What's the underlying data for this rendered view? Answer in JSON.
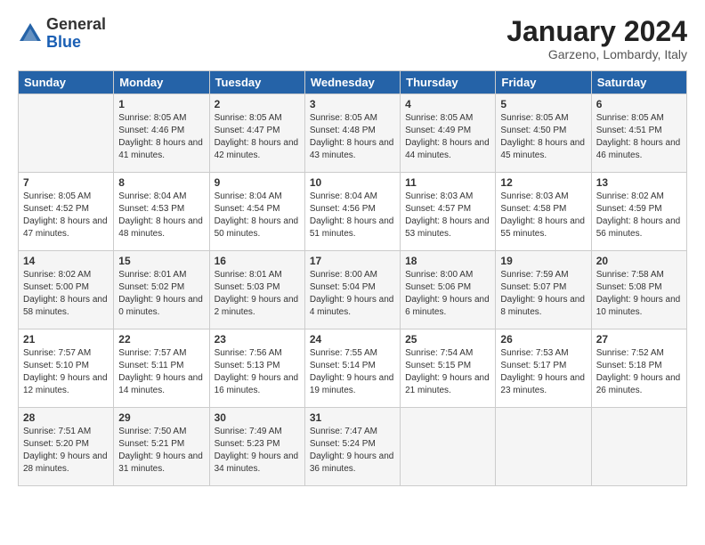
{
  "header": {
    "logo_general": "General",
    "logo_blue": "Blue",
    "month_title": "January 2024",
    "location": "Garzeno, Lombardy, Italy"
  },
  "weekdays": [
    "Sunday",
    "Monday",
    "Tuesday",
    "Wednesday",
    "Thursday",
    "Friday",
    "Saturday"
  ],
  "weeks": [
    [
      {
        "day": "",
        "sunrise": "",
        "sunset": "",
        "daylight": ""
      },
      {
        "day": "1",
        "sunrise": "8:05 AM",
        "sunset": "4:46 PM",
        "daylight": "8 hours and 41 minutes."
      },
      {
        "day": "2",
        "sunrise": "8:05 AM",
        "sunset": "4:47 PM",
        "daylight": "8 hours and 42 minutes."
      },
      {
        "day": "3",
        "sunrise": "8:05 AM",
        "sunset": "4:48 PM",
        "daylight": "8 hours and 43 minutes."
      },
      {
        "day": "4",
        "sunrise": "8:05 AM",
        "sunset": "4:49 PM",
        "daylight": "8 hours and 44 minutes."
      },
      {
        "day": "5",
        "sunrise": "8:05 AM",
        "sunset": "4:50 PM",
        "daylight": "8 hours and 45 minutes."
      },
      {
        "day": "6",
        "sunrise": "8:05 AM",
        "sunset": "4:51 PM",
        "daylight": "8 hours and 46 minutes."
      }
    ],
    [
      {
        "day": "7",
        "sunrise": "8:05 AM",
        "sunset": "4:52 PM",
        "daylight": "8 hours and 47 minutes."
      },
      {
        "day": "8",
        "sunrise": "8:04 AM",
        "sunset": "4:53 PM",
        "daylight": "8 hours and 48 minutes."
      },
      {
        "day": "9",
        "sunrise": "8:04 AM",
        "sunset": "4:54 PM",
        "daylight": "8 hours and 50 minutes."
      },
      {
        "day": "10",
        "sunrise": "8:04 AM",
        "sunset": "4:56 PM",
        "daylight": "8 hours and 51 minutes."
      },
      {
        "day": "11",
        "sunrise": "8:03 AM",
        "sunset": "4:57 PM",
        "daylight": "8 hours and 53 minutes."
      },
      {
        "day": "12",
        "sunrise": "8:03 AM",
        "sunset": "4:58 PM",
        "daylight": "8 hours and 55 minutes."
      },
      {
        "day": "13",
        "sunrise": "8:02 AM",
        "sunset": "4:59 PM",
        "daylight": "8 hours and 56 minutes."
      }
    ],
    [
      {
        "day": "14",
        "sunrise": "8:02 AM",
        "sunset": "5:00 PM",
        "daylight": "8 hours and 58 minutes."
      },
      {
        "day": "15",
        "sunrise": "8:01 AM",
        "sunset": "5:02 PM",
        "daylight": "9 hours and 0 minutes."
      },
      {
        "day": "16",
        "sunrise": "8:01 AM",
        "sunset": "5:03 PM",
        "daylight": "9 hours and 2 minutes."
      },
      {
        "day": "17",
        "sunrise": "8:00 AM",
        "sunset": "5:04 PM",
        "daylight": "9 hours and 4 minutes."
      },
      {
        "day": "18",
        "sunrise": "8:00 AM",
        "sunset": "5:06 PM",
        "daylight": "9 hours and 6 minutes."
      },
      {
        "day": "19",
        "sunrise": "7:59 AM",
        "sunset": "5:07 PM",
        "daylight": "9 hours and 8 minutes."
      },
      {
        "day": "20",
        "sunrise": "7:58 AM",
        "sunset": "5:08 PM",
        "daylight": "9 hours and 10 minutes."
      }
    ],
    [
      {
        "day": "21",
        "sunrise": "7:57 AM",
        "sunset": "5:10 PM",
        "daylight": "9 hours and 12 minutes."
      },
      {
        "day": "22",
        "sunrise": "7:57 AM",
        "sunset": "5:11 PM",
        "daylight": "9 hours and 14 minutes."
      },
      {
        "day": "23",
        "sunrise": "7:56 AM",
        "sunset": "5:13 PM",
        "daylight": "9 hours and 16 minutes."
      },
      {
        "day": "24",
        "sunrise": "7:55 AM",
        "sunset": "5:14 PM",
        "daylight": "9 hours and 19 minutes."
      },
      {
        "day": "25",
        "sunrise": "7:54 AM",
        "sunset": "5:15 PM",
        "daylight": "9 hours and 21 minutes."
      },
      {
        "day": "26",
        "sunrise": "7:53 AM",
        "sunset": "5:17 PM",
        "daylight": "9 hours and 23 minutes."
      },
      {
        "day": "27",
        "sunrise": "7:52 AM",
        "sunset": "5:18 PM",
        "daylight": "9 hours and 26 minutes."
      }
    ],
    [
      {
        "day": "28",
        "sunrise": "7:51 AM",
        "sunset": "5:20 PM",
        "daylight": "9 hours and 28 minutes."
      },
      {
        "day": "29",
        "sunrise": "7:50 AM",
        "sunset": "5:21 PM",
        "daylight": "9 hours and 31 minutes."
      },
      {
        "day": "30",
        "sunrise": "7:49 AM",
        "sunset": "5:23 PM",
        "daylight": "9 hours and 34 minutes."
      },
      {
        "day": "31",
        "sunrise": "7:47 AM",
        "sunset": "5:24 PM",
        "daylight": "9 hours and 36 minutes."
      },
      {
        "day": "",
        "sunrise": "",
        "sunset": "",
        "daylight": ""
      },
      {
        "day": "",
        "sunrise": "",
        "sunset": "",
        "daylight": ""
      },
      {
        "day": "",
        "sunrise": "",
        "sunset": "",
        "daylight": ""
      }
    ]
  ],
  "labels": {
    "sunrise_prefix": "Sunrise: ",
    "sunset_prefix": "Sunset: ",
    "daylight_prefix": "Daylight: "
  }
}
